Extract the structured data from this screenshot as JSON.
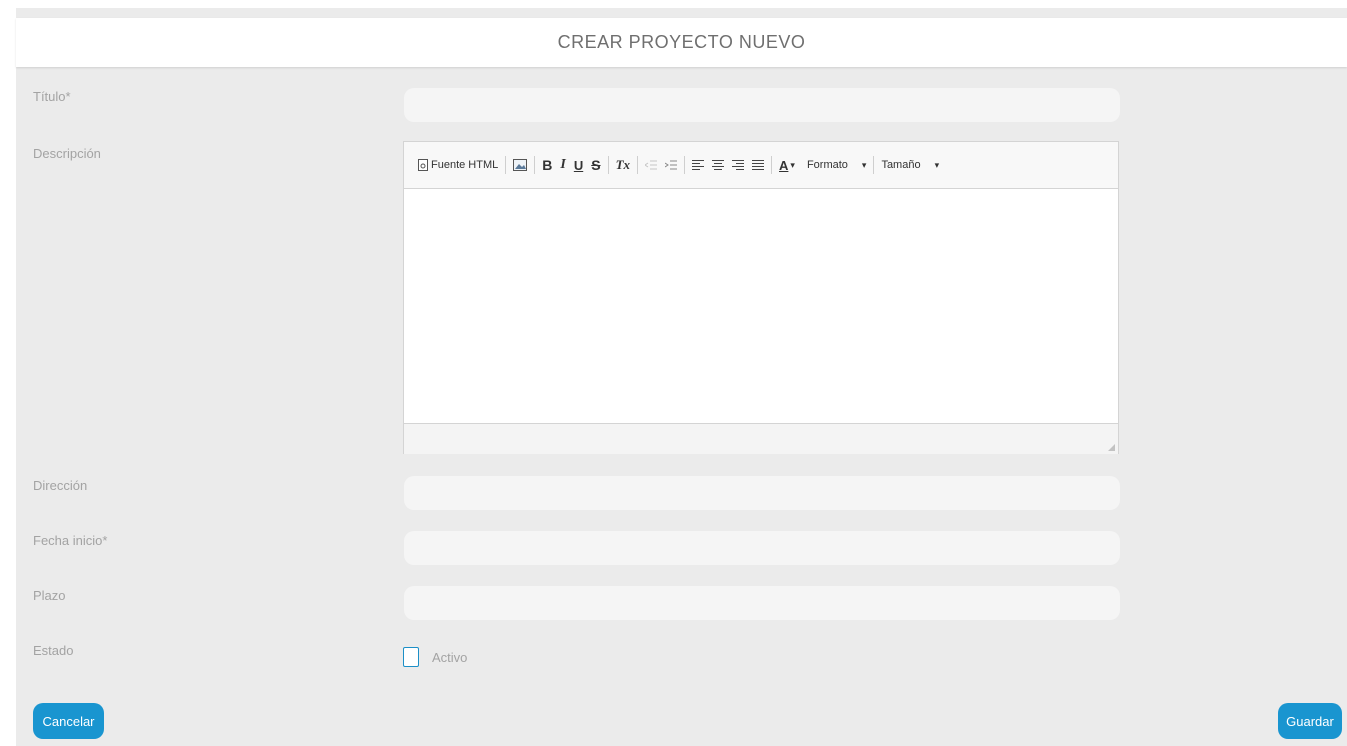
{
  "header": {
    "title": "CREAR PROYECTO NUEVO"
  },
  "form": {
    "titulo": {
      "label": "Título*",
      "value": ""
    },
    "descripcion": {
      "label": "Descripción"
    },
    "direccion": {
      "label": "Dirección",
      "value": ""
    },
    "fecha_inicio": {
      "label": "Fecha inicio*",
      "value": ""
    },
    "plazo": {
      "label": "Plazo",
      "value": ""
    },
    "estado": {
      "label": "Estado",
      "checkbox_label": "Activo",
      "checked": false
    }
  },
  "editor": {
    "toolbar": {
      "source_label": "Fuente HTML",
      "bold": "B",
      "italic": "I",
      "underline": "U",
      "strike": "S",
      "clear_format": "Tx",
      "text_color": "A",
      "format_label": "Formato",
      "size_label": "Tamaño"
    },
    "content": ""
  },
  "buttons": {
    "cancel": "Cancelar",
    "save": "Guardar"
  },
  "colors": {
    "accent": "#1995d0",
    "panel_bg": "#ebebeb"
  }
}
